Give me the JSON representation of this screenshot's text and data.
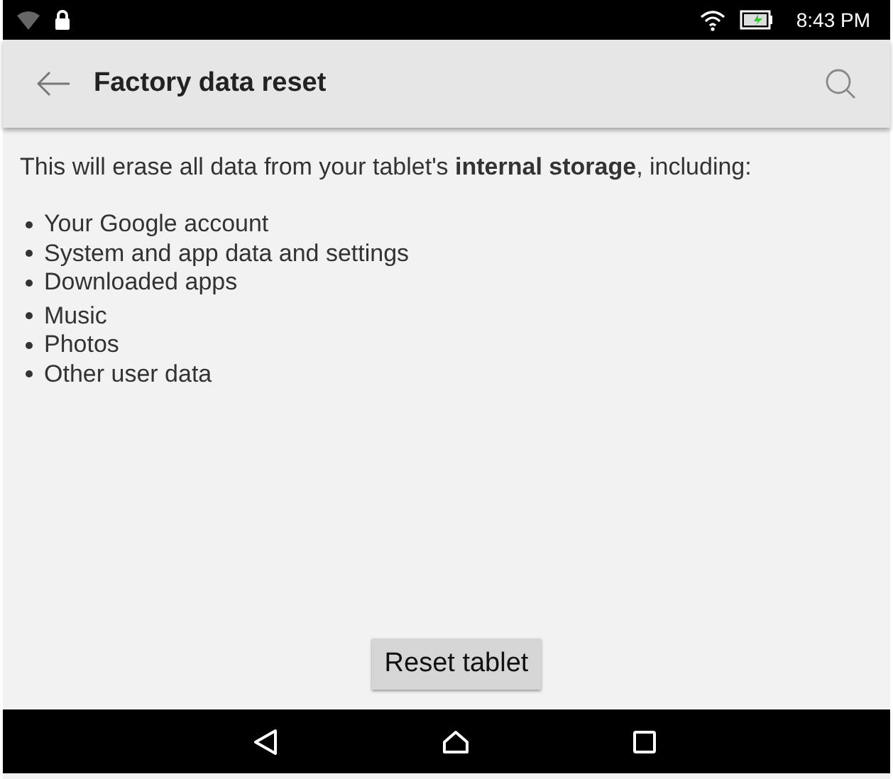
{
  "status_bar": {
    "time": "8:43 PM"
  },
  "app_bar": {
    "title": "Factory data reset"
  },
  "intro": "This will erase all data from your tablet's **internal storage**, including:",
  "items": [
    "Your Google account",
    "System and app data and settings",
    "Downloaded apps",
    "Music",
    "Photos",
    "Other user data"
  ],
  "button": "Reset tablet"
}
